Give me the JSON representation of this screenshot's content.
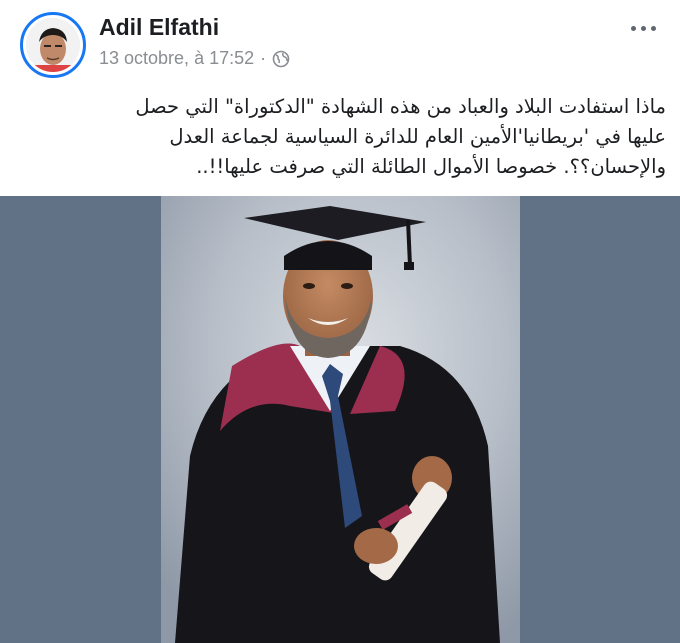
{
  "post": {
    "author": "Adil Elfathi",
    "timestamp": "13 octobre, à 17:52",
    "separator": "·",
    "privacy_icon": "globe-icon",
    "more_icon": "more-horizontal-icon",
    "text_lines": [
      "ماذا استفادت البلاد والعباد من هذه الشهادة \"الدكتوراة\" التي حصل",
      "عليها في 'بريطانيا'الأمين العام للدائرة السياسية لجماعة العدل",
      "والإحسان؟؟. خصوصا الأموال الطائلة التي صرفت عليها!!.."
    ]
  },
  "colors": {
    "accent": "#1877f2",
    "text": "#1c1e21",
    "secondary_text": "#8a8d91",
    "photo_background": "#617287",
    "studio_backdrop": "#b9c0c9",
    "gown": "#15151a",
    "hood": "#9c2f4f"
  }
}
